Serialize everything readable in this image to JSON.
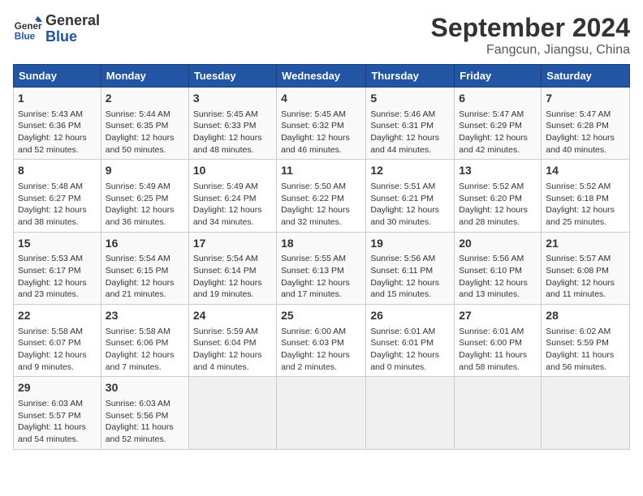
{
  "header": {
    "logo_line1": "General",
    "logo_line2": "Blue",
    "month_title": "September 2024",
    "location": "Fangcun, Jiangsu, China"
  },
  "weekdays": [
    "Sunday",
    "Monday",
    "Tuesday",
    "Wednesday",
    "Thursday",
    "Friday",
    "Saturday"
  ],
  "weeks": [
    [
      {
        "day": "1",
        "info": "Sunrise: 5:43 AM\nSunset: 6:36 PM\nDaylight: 12 hours\nand 52 minutes."
      },
      {
        "day": "2",
        "info": "Sunrise: 5:44 AM\nSunset: 6:35 PM\nDaylight: 12 hours\nand 50 minutes."
      },
      {
        "day": "3",
        "info": "Sunrise: 5:45 AM\nSunset: 6:33 PM\nDaylight: 12 hours\nand 48 minutes."
      },
      {
        "day": "4",
        "info": "Sunrise: 5:45 AM\nSunset: 6:32 PM\nDaylight: 12 hours\nand 46 minutes."
      },
      {
        "day": "5",
        "info": "Sunrise: 5:46 AM\nSunset: 6:31 PM\nDaylight: 12 hours\nand 44 minutes."
      },
      {
        "day": "6",
        "info": "Sunrise: 5:47 AM\nSunset: 6:29 PM\nDaylight: 12 hours\nand 42 minutes."
      },
      {
        "day": "7",
        "info": "Sunrise: 5:47 AM\nSunset: 6:28 PM\nDaylight: 12 hours\nand 40 minutes."
      }
    ],
    [
      {
        "day": "8",
        "info": "Sunrise: 5:48 AM\nSunset: 6:27 PM\nDaylight: 12 hours\nand 38 minutes."
      },
      {
        "day": "9",
        "info": "Sunrise: 5:49 AM\nSunset: 6:25 PM\nDaylight: 12 hours\nand 36 minutes."
      },
      {
        "day": "10",
        "info": "Sunrise: 5:49 AM\nSunset: 6:24 PM\nDaylight: 12 hours\nand 34 minutes."
      },
      {
        "day": "11",
        "info": "Sunrise: 5:50 AM\nSunset: 6:22 PM\nDaylight: 12 hours\nand 32 minutes."
      },
      {
        "day": "12",
        "info": "Sunrise: 5:51 AM\nSunset: 6:21 PM\nDaylight: 12 hours\nand 30 minutes."
      },
      {
        "day": "13",
        "info": "Sunrise: 5:52 AM\nSunset: 6:20 PM\nDaylight: 12 hours\nand 28 minutes."
      },
      {
        "day": "14",
        "info": "Sunrise: 5:52 AM\nSunset: 6:18 PM\nDaylight: 12 hours\nand 25 minutes."
      }
    ],
    [
      {
        "day": "15",
        "info": "Sunrise: 5:53 AM\nSunset: 6:17 PM\nDaylight: 12 hours\nand 23 minutes."
      },
      {
        "day": "16",
        "info": "Sunrise: 5:54 AM\nSunset: 6:15 PM\nDaylight: 12 hours\nand 21 minutes."
      },
      {
        "day": "17",
        "info": "Sunrise: 5:54 AM\nSunset: 6:14 PM\nDaylight: 12 hours\nand 19 minutes."
      },
      {
        "day": "18",
        "info": "Sunrise: 5:55 AM\nSunset: 6:13 PM\nDaylight: 12 hours\nand 17 minutes."
      },
      {
        "day": "19",
        "info": "Sunrise: 5:56 AM\nSunset: 6:11 PM\nDaylight: 12 hours\nand 15 minutes."
      },
      {
        "day": "20",
        "info": "Sunrise: 5:56 AM\nSunset: 6:10 PM\nDaylight: 12 hours\nand 13 minutes."
      },
      {
        "day": "21",
        "info": "Sunrise: 5:57 AM\nSunset: 6:08 PM\nDaylight: 12 hours\nand 11 minutes."
      }
    ],
    [
      {
        "day": "22",
        "info": "Sunrise: 5:58 AM\nSunset: 6:07 PM\nDaylight: 12 hours\nand 9 minutes."
      },
      {
        "day": "23",
        "info": "Sunrise: 5:58 AM\nSunset: 6:06 PM\nDaylight: 12 hours\nand 7 minutes."
      },
      {
        "day": "24",
        "info": "Sunrise: 5:59 AM\nSunset: 6:04 PM\nDaylight: 12 hours\nand 4 minutes."
      },
      {
        "day": "25",
        "info": "Sunrise: 6:00 AM\nSunset: 6:03 PM\nDaylight: 12 hours\nand 2 minutes."
      },
      {
        "day": "26",
        "info": "Sunrise: 6:01 AM\nSunset: 6:01 PM\nDaylight: 12 hours\nand 0 minutes."
      },
      {
        "day": "27",
        "info": "Sunrise: 6:01 AM\nSunset: 6:00 PM\nDaylight: 11 hours\nand 58 minutes."
      },
      {
        "day": "28",
        "info": "Sunrise: 6:02 AM\nSunset: 5:59 PM\nDaylight: 11 hours\nand 56 minutes."
      }
    ],
    [
      {
        "day": "29",
        "info": "Sunrise: 6:03 AM\nSunset: 5:57 PM\nDaylight: 11 hours\nand 54 minutes."
      },
      {
        "day": "30",
        "info": "Sunrise: 6:03 AM\nSunset: 5:56 PM\nDaylight: 11 hours\nand 52 minutes."
      },
      {
        "day": "",
        "info": ""
      },
      {
        "day": "",
        "info": ""
      },
      {
        "day": "",
        "info": ""
      },
      {
        "day": "",
        "info": ""
      },
      {
        "day": "",
        "info": ""
      }
    ]
  ]
}
